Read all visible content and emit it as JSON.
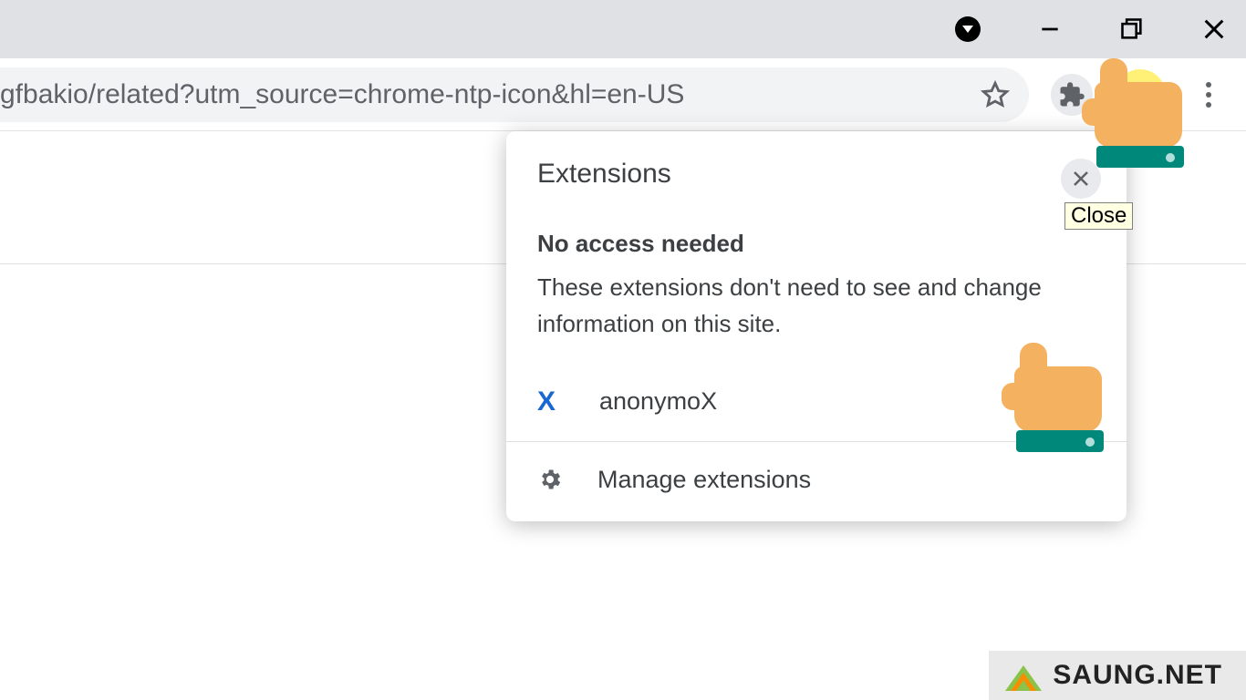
{
  "window": {
    "minimize_tooltip": "Minimize",
    "maximize_tooltip": "Restore",
    "close_tooltip": "Close"
  },
  "toolbar": {
    "url_visible_fragment": "gfbakio/related?utm_source=chrome-ntp-icon&hl=en-US",
    "star_tooltip": "Bookmark this tab",
    "extensions_tooltip": "Extensions",
    "menu_tooltip": "Customize and control Google Chrome"
  },
  "extensions_popover": {
    "title": "Extensions",
    "close_tooltip": "Close",
    "no_access_heading": "No access needed",
    "no_access_desc": "These extensions don't need to see and change information on this site.",
    "items": [
      {
        "name": "anonymoX",
        "icon_letter": "X"
      }
    ],
    "manage_label": "Manage extensions"
  },
  "watermark": {
    "text": "SAUNG.NET"
  }
}
